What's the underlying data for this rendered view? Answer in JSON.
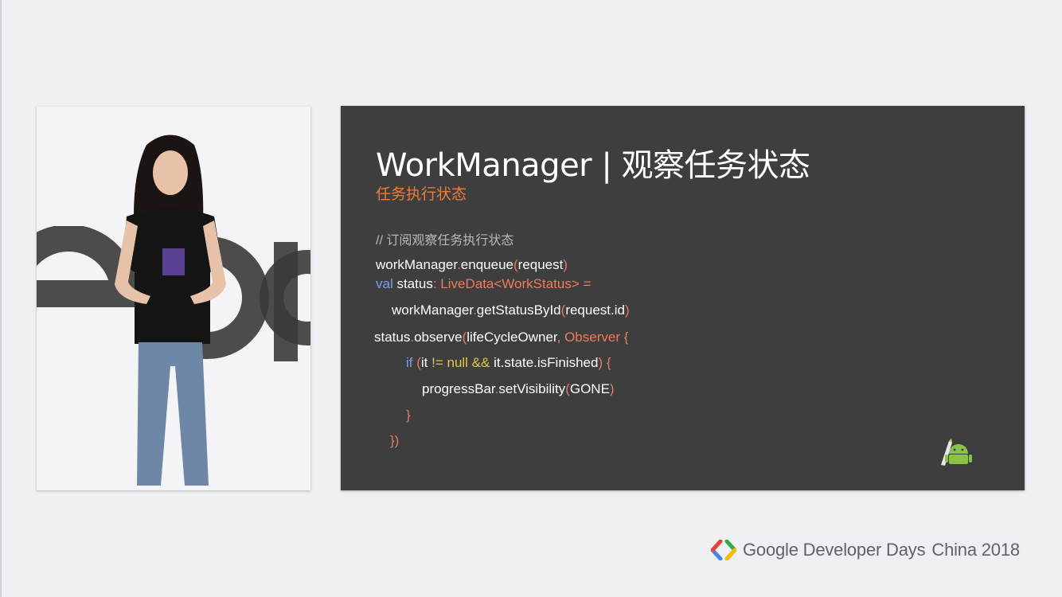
{
  "video": {
    "background_letters": "eop"
  },
  "slide": {
    "title": "WorkManager | 观察任务状态",
    "subtitle": "任务执行状态",
    "code": {
      "comment": "// 订阅观察任务执行状态",
      "l1_obj": "workManager",
      "l1_dot": ".",
      "l1_fn": "enqueue",
      "l1_open": "(",
      "l1_arg": "request",
      "l1_close": ")",
      "l2_kw": "val",
      "l2_name": " status",
      "l2_colon": ": ",
      "l2_type": "LiveData<WorkStatus> =",
      "l3_obj": "workManager",
      "l3_dot": ".",
      "l3_fn": "getStatusById",
      "l3_open": "(",
      "l3_arg": "request.id",
      "l3_close": ")",
      "l4_obj": "status",
      "l4_dot": ".",
      "l4_fn": "observe",
      "l4_open": "(",
      "l4_arg": "lifeCycleOwner",
      "l4_comma": ", ",
      "l4_type": "Observer {",
      "l5_kw": "if",
      "l5_open": " (",
      "l5_it": "it ",
      "l5_op": "!= null &&",
      "l5_rest": " it.state.isFinished",
      "l5_close": ") {",
      "l6_obj": "progressBar",
      "l6_dot": ".",
      "l6_fn": "setVisibility",
      "l6_open": "(",
      "l6_arg": "GONE",
      "l6_close": ")",
      "l7": "}",
      "l8": "})"
    }
  },
  "footer": {
    "brand": "Google Developer Days",
    "event": "China 2018"
  },
  "colors": {
    "slide_bg": "#3e3e3e",
    "accent_orange": "#f07a3a",
    "keyword_blue": "#7f9ee6",
    "type_red": "#f07a5a",
    "operator_yellow": "#e0c848"
  }
}
